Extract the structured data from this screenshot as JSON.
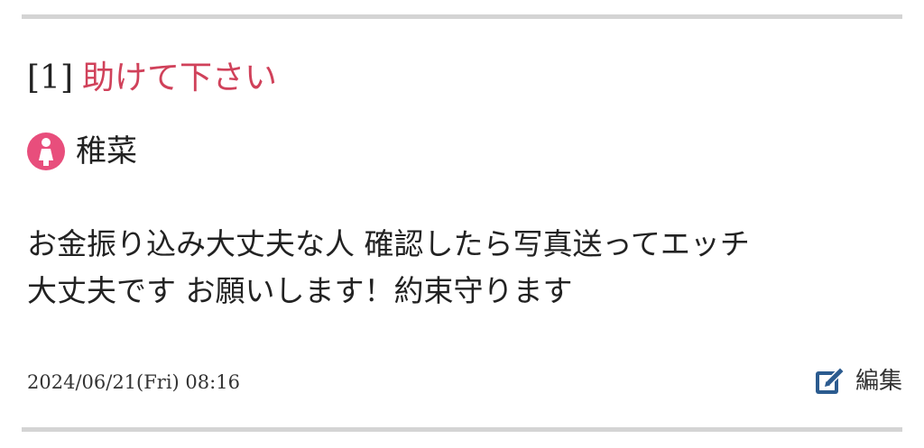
{
  "post": {
    "number": "[1]",
    "title": "助けて下さい",
    "author": {
      "name": "稚菜",
      "gender_icon": "female-icon"
    },
    "body_lines": [
      "お金振り込み大丈夫な人 確認したら写真送ってエッチ",
      "大丈夫です お願いします！約束守ります"
    ],
    "timestamp": "2024/06/21(Fri) 08:16",
    "edit": {
      "icon": "edit-icon",
      "label": "編集"
    }
  },
  "colors": {
    "title": "#d0415a",
    "female_icon_bg": "#e84e7c",
    "edit_icon": "#2b5b8f",
    "divider": "#d4d4d4"
  }
}
